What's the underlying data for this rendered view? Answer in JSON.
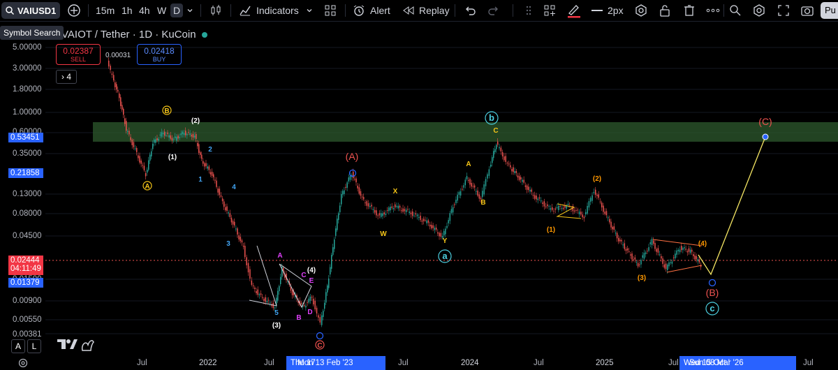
{
  "toolbar": {
    "symbol": "VAIUSD1",
    "intervals": [
      "15m",
      "1h",
      "4h",
      "W",
      "D"
    ],
    "indicators_label": "Indicators",
    "alert_label": "Alert",
    "replay_label": "Replay",
    "line_width_label": "2px",
    "publish_label": "Pu"
  },
  "tooltip": {
    "symbol_search": "Symbol Search"
  },
  "header": {
    "title": "VAIOT / Tether · 1D · KuCoin",
    "sell_price": "0.02387",
    "sell_label": "SELL",
    "spread": "0.00031",
    "buy_price": "0.02418",
    "buy_label": "BUY",
    "indicator_count": "4"
  },
  "price_axis": {
    "ticks": [
      "5.00000",
      "3.00000",
      "1.80000",
      "1.00000",
      "0.60000",
      "0.35000",
      "0.13000",
      "0.08000",
      "0.04500",
      "0.01500",
      "0.00900",
      "0.00550",
      "0.00381"
    ],
    "highlight_zone_top": "0.53451",
    "highlight_zone_bottom": "0.21858",
    "current_price": "0.02444",
    "countdown": "04:11:49",
    "blue_price": "0.01379"
  },
  "time_axis": {
    "labels": [
      "Jul",
      "2022",
      "Jul",
      "Jul",
      "2024",
      "Jul",
      "2025",
      "Jul",
      "Jul"
    ],
    "crosshair_left": "Thu 17",
    "crosshair_mid": "Mon 13 Feb '23",
    "crosshair_right_a": "Wed 15 Oct '",
    "crosshair_right_b": "Sun 08 Mar '26"
  },
  "wave_labels": [
    {
      "text": "B",
      "color": "#f5c518",
      "circled": true
    },
    {
      "text": "A",
      "color": "#f5c518",
      "circled": true
    },
    {
      "text": "(2)",
      "color": "#ffffff"
    },
    {
      "text": "(1)",
      "color": "#ffffff"
    },
    {
      "text": "2",
      "color": "#42a5f5"
    },
    {
      "text": "1",
      "color": "#42a5f5"
    },
    {
      "text": "4",
      "color": "#42a5f5"
    },
    {
      "text": "3",
      "color": "#42a5f5"
    },
    {
      "text": "5",
      "color": "#42a5f5"
    },
    {
      "text": "(3)",
      "color": "#ffffff"
    },
    {
      "text": "(4)",
      "color": "#ffffff"
    },
    {
      "text": "A",
      "color": "#e040fb"
    },
    {
      "text": "B",
      "color": "#e040fb"
    },
    {
      "text": "C",
      "color": "#e040fb"
    },
    {
      "text": "D",
      "color": "#e040fb"
    },
    {
      "text": "E",
      "color": "#e040fb"
    },
    {
      "text": "(A)",
      "color": "#ef5350"
    },
    {
      "text": "W",
      "color": "#f5c518"
    },
    {
      "text": "X",
      "color": "#f5c518"
    },
    {
      "text": "Y",
      "color": "#f5c518"
    },
    {
      "text": "a",
      "color": "#4dd0e1",
      "circled": true
    },
    {
      "text": "A",
      "color": "#f5c518"
    },
    {
      "text": "B",
      "color": "#f5c518"
    },
    {
      "text": "C",
      "color": "#f5c518"
    },
    {
      "text": "b",
      "color": "#4dd0e1",
      "circled": true
    },
    {
      "text": "(1)",
      "color": "#ff9800"
    },
    {
      "text": "(2)",
      "color": "#ff9800"
    },
    {
      "text": "(3)",
      "color": "#ff9800"
    },
    {
      "text": "(4)",
      "color": "#ff9800"
    },
    {
      "text": "(C)",
      "color": "#ef5350"
    },
    {
      "text": "(B)",
      "color": "#ef5350"
    },
    {
      "text": "c",
      "color": "#4dd0e1",
      "circled": true
    },
    {
      "text": "C",
      "color": "#ef5350",
      "circled": true
    }
  ],
  "bottom": {
    "a_label": "A",
    "l_label": "L"
  },
  "colors": {
    "background": "#000000",
    "zone": "#2e5a2e",
    "up": "#26a69a",
    "down": "#ef5350",
    "accent": "#2962ff",
    "projection": "#f5e663"
  }
}
